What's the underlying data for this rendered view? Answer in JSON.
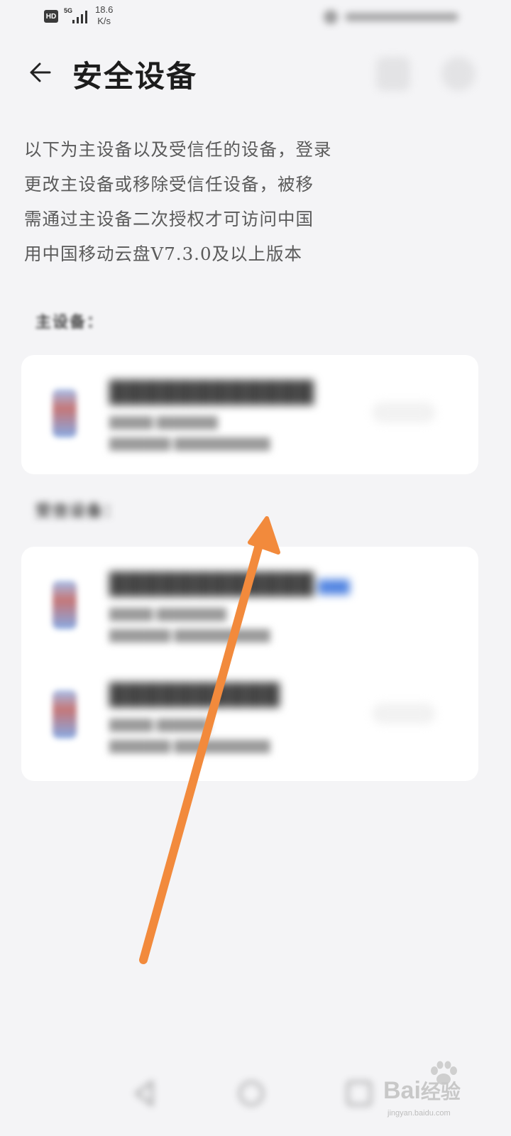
{
  "status_bar": {
    "hd": "HD",
    "network": "5G",
    "speed_value": "18.6",
    "speed_unit": "K/s"
  },
  "header": {
    "back_icon": "arrow-left-icon",
    "title": "安全设备"
  },
  "description": {
    "line1": "以下为主设备以及受信任的设备，登录",
    "line2": "更改主设备或移除受信任设备，被移",
    "line3": "需通过主设备二次授权才可访问中国",
    "line4": "用中国移动云盘V7.3.0及以上版本"
  },
  "sections": {
    "primary_label": "主设备：",
    "trusted_label": "受信设备："
  },
  "primary_devices": [
    {
      "icon": "phone-icon"
    }
  ],
  "trusted_devices": [
    {
      "icon": "phone-icon"
    },
    {
      "icon": "phone-icon"
    }
  ],
  "watermark": {
    "brand": "Bai",
    "brand_suffix": "经验",
    "url": "jingyan.baidu.com"
  },
  "colors": {
    "background": "#f4f4f6",
    "card": "#ffffff",
    "arrow": "#f28a3c",
    "title": "#1c1c1c"
  }
}
